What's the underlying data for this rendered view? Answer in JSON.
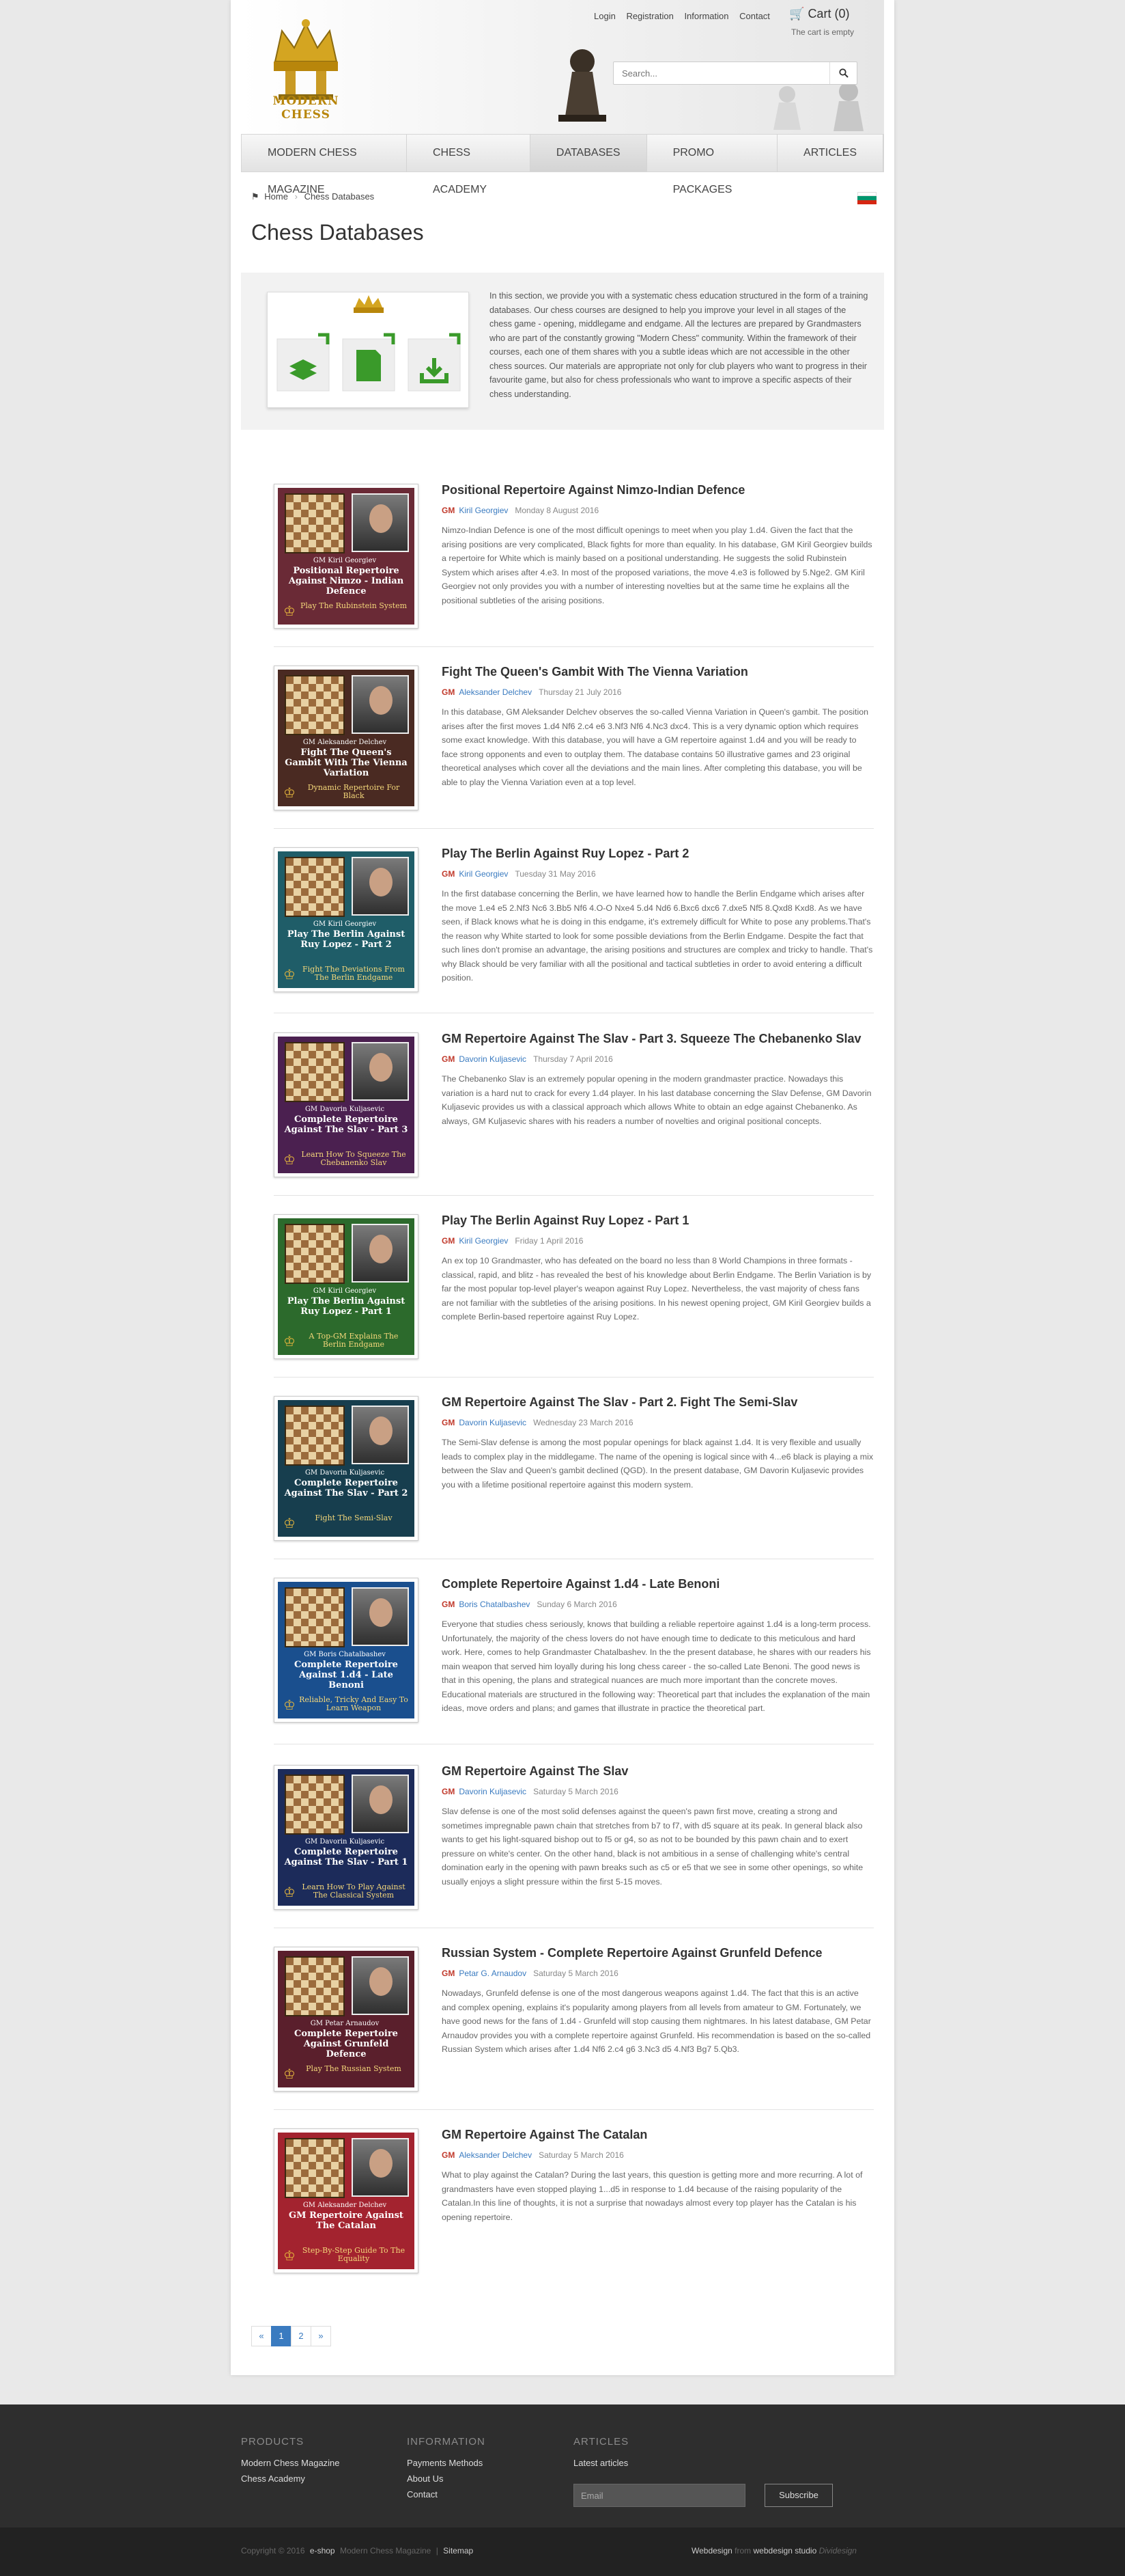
{
  "header": {
    "logo_text": "MODERN CHESS",
    "top_links": [
      "Login",
      "Registration",
      "Information",
      "Contact"
    ],
    "cart_label": "Cart (0)",
    "cart_status": "The cart is empty",
    "search_placeholder": "Search..."
  },
  "nav": [
    "MODERN CHESS MAGAZINE",
    "CHESS ACADEMY",
    "DATABASES",
    "PROMO PACKAGES",
    "ARTICLES"
  ],
  "breadcrumb": {
    "home": "Home",
    "current": "Chess Databases"
  },
  "page_title": "Chess Databases",
  "intro_text": "In this section, we provide you with a systematic chess education structured in the form of a training databases. Our chess courses are designed to help you improve your level in all stages of the chess game - opening, middlegame and endgame. All the lectures are prepared by Grandmasters who are part of the constantly growing \"Modern Chess\" community. Within the framework of their courses, each one of them shares with you a subtle ideas which are not accessible in the other chess sources. Our materials are appropriate not only for club players who want to progress in their favourite game, but also for chess professionals who want to improve a specific aspects of their chess understanding.",
  "items": [
    {
      "title": "Positional Repertoire Against Nimzo-Indian Defence",
      "gm": "GM",
      "author": "Kiril Georgiev",
      "date": "Monday 8 August 2016",
      "cover_gm": "GM Kiril Georgiev",
      "cover_title": "Positional Repertoire Against Nimzo - Indian Defence",
      "cover_sub": "Play The Rubinstein System",
      "color": "#6a2a36",
      "desc": "Nimzo-Indian Defence is one of the most difficult openings to meet when you play 1.d4. Given the fact that the arising positions are very complicated, Black fights for more than equality. In his database, GM Kiril Georgiev builds a repertoire for White which is mainly based on a positional understanding. He suggests the solid Rubinstein System which arises after 4.e3. In most of the proposed variations, the move 4.e3 is followed by 5.Nge2. GM Kiril Georgiev not only provides you with a number of interesting novelties but at the same time he explains all the positional subtleties of the arising positions."
    },
    {
      "title": "Fight The Queen's Gambit With The Vienna Variation",
      "gm": "GM",
      "author": "Aleksander Delchev",
      "date": "Thursday 21 July 2016",
      "cover_gm": "GM Aleksander Delchev",
      "cover_title": "Fight The Queen's Gambit With The Vienna Variation",
      "cover_sub": "Dynamic Repertoire For Black",
      "color": "#4a2a22",
      "desc": "In this database, GM Aleksander Delchev observes the so-called Vienna Variation in Queen's gambit. The position arises after the first moves 1.d4 Nf6 2.c4 e6 3.Nf3 Nf6 4.Nc3 dxc4. This is a very dynamic option which requires some exact knowledge. With this database, you will have a GM repertoire against 1.d4 and you will be ready to face strong opponents and even to outplay them. The database contains 50 illustrative games and 23 original theoretical analyses which cover all the deviations and the main lines. After completing this database, you will be able to play the Vienna Variation even at a top level."
    },
    {
      "title": "Play The Berlin Against Ruy Lopez - Part 2",
      "gm": "GM",
      "author": "Kiril Georgiev",
      "date": "Tuesday 31 May 2016",
      "cover_gm": "GM Kiril Georgiev",
      "cover_title": "Play The Berlin Against Ruy Lopez - Part 2",
      "cover_sub": "Fight The Deviations From The Berlin Endgame",
      "color": "#1f5d68",
      "desc": "In the first database concerning the Berlin, we have learned how to handle the Berlin Endgame which arises after the move 1.e4 e5 2.Nf3 Nc6 3.Bb5 Nf6 4.O-O Nxe4 5.d4 Nd6 6.Bxc6 dxc6 7.dxe5 Nf5 8.Qxd8 Kxd8. As we have seen, if Black knows what he is doing in this endgame, it's extremely difficult for White to pose any problems.That's the reason why White started to look for some possible deviations from the Berlin Endgame. Despite the fact that such lines don't promise an advantage, the arising positions and structures are complex and tricky to handle. That's why Black should be very familiar with all the positional and tactical subtleties in order to avoid entering a difficult position."
    },
    {
      "title": "GM Repertoire Against The Slav - Part 3. Squeeze The Chebanenko Slav",
      "gm": "GM",
      "author": "Davorin Kuljasevic",
      "date": "Thursday 7 April 2016",
      "cover_gm": "GM Davorin Kuljasevic",
      "cover_title": "Complete Repertoire Against The Slav - Part 3",
      "cover_sub": "Learn How To Squeeze The Chebanenko Slav",
      "color": "#4b2050",
      "desc": "The Chebanenko Slav is an extremely popular opening in the modern grandmaster practice. Nowadays this variation is a hard nut to crack for every 1.d4 player. In his last database concerning the Slav Defense, GM Davorin Kuljasevic provides us with a classical approach which allows White to obtain an edge against Chebanenko. As always, GM Kuljasevic shares with his readers a number of novelties and original positional concepts."
    },
    {
      "title": "Play The Berlin Against Ruy Lopez - Part 1",
      "gm": "GM",
      "author": "Kiril Georgiev",
      "date": "Friday 1 April 2016",
      "cover_gm": "GM Kiril Georgiev",
      "cover_title": "Play The Berlin Against Ruy Lopez - Part 1",
      "cover_sub": "A Top-GM Explains The Berlin Endgame",
      "color": "#2c6a2c",
      "desc": "An ex top 10 Grandmaster, who has defeated on the board no less than 8 World Champions in three formats - classical, rapid, and blitz - has revealed the best of his knowledge about Berlin Endgame. The Berlin Variation is by far the most popular top-level player's weapon against Ruy Lopez. Nevertheless, the vast majority of chess fans are not familiar with the subtleties of the arising positions. In his newest opening project, GM Kiril Georgiev builds a complete Berlin-based repertoire against Ruy Lopez."
    },
    {
      "title": "GM Repertoire Against The Slav - Part 2. Fight The Semi-Slav",
      "gm": "GM",
      "author": "Davorin Kuljasevic",
      "date": "Wednesday 23 March 2016",
      "cover_gm": "GM Davorin Kuljasevic",
      "cover_title": "Complete Repertoire Against The Slav - Part 2",
      "cover_sub": "Fight The Semi-Slav",
      "color": "#173e4e",
      "desc": "The Semi-Slav defense is among the most popular openings for black against 1.d4. It is very flexible and usually leads to complex play in the middlegame. The name of the opening is logical since with 4...e6 black is playing a mix between the Slav and Queen's gambit declined (QGD). In the present database, GM Davorin Kuljasevic provides you with a lifetime positional repertoire against this modern system."
    },
    {
      "title": "Complete Repertoire Against 1.d4 - Late Benoni",
      "gm": "GM",
      "author": "Boris Chatalbashev",
      "date": "Sunday 6 March 2016",
      "cover_gm": "GM Boris Chatalbashev",
      "cover_title": "Complete Repertoire Against 1.d4 - Late Benoni",
      "cover_sub": "Reliable, Tricky And Easy To Learn Weapon",
      "color": "#1a4f8e",
      "desc": "Everyone that studies chess seriously, knows that building a reliable repertoire against 1.d4 is a long-term process. Unfortunately, the majority of the chess lovers do not have enough time to dedicate to this meticulous and hard work. Here, comes to help Grandmaster Chatalbashev. In the the present database, he shares with our readers his main weapon that served him loyally during his long chess career - the so-called Late Benoni. The good news is that in this opening, the plans and strategical nuances are much more important than the concrete moves. Educational materials are structured in the following way: Theoretical part that includes the explanation of the main ideas, move orders and plans; and games that illustrate in practice the theoretical part."
    },
    {
      "title": "GM Repertoire Against The Slav",
      "gm": "GM",
      "author": "Davorin Kuljasevic",
      "date": "Saturday 5 March 2016",
      "cover_gm": "GM Davorin Kuljasevic",
      "cover_title": "Complete Repertoire Against The Slav - Part 1",
      "cover_sub": "Learn How To Play Against The Classical System",
      "color": "#1c2b5a",
      "desc": "Slav defense is one of the most solid defenses against the queen's pawn first move, creating a strong and sometimes impregnable pawn chain that stretches from b7 to f7, with d5 square at its peak. In general black also wants to get his light-squared bishop out to f5 or g4, so as not to be bounded by this pawn chain and to exert pressure on white's center. On the other hand, black is not ambitious in a sense of challenging white's central domination early in the opening with pawn breaks such as c5 or e5 that we see in some other openings, so white usually enjoys a slight pressure within the first 5-15 moves."
    },
    {
      "title": "Russian System - Complete Repertoire Against Grunfeld Defence",
      "gm": "GM",
      "author": "Petar G. Arnaudov",
      "date": "Saturday 5 March 2016",
      "cover_gm": "GM Petar Arnaudov",
      "cover_title": "Complete Repertoire Against Grunfeld Defence",
      "cover_sub": "Play The Russian System",
      "color": "#5a1f2c",
      "desc": "Nowadays, Grunfeld defense is one of the most dangerous weapons against 1.d4. The fact that this is an active and complex opening, explains it's popularity among players from all levels from amateur to GM. Fortunately, we have good news for the fans of 1.d4 - Grunfeld will stop causing them nightmares. In his latest database, GM Petar Arnaudov provides you with a complete repertoire against Grunfeld. His recommendation is based on the so-called Russian System which arises after 1.d4 Nf6 2.c4 g6 3.Nc3 d5 4.Nf3 Bg7 5.Qb3."
    },
    {
      "title": "GM Repertoire Against The Catalan",
      "gm": "GM",
      "author": "Aleksander Delchev",
      "date": "Saturday 5 March 2016",
      "cover_gm": "GM Aleksander Delchev",
      "cover_title": "GM Repertoire Against The Catalan",
      "cover_sub": "Step-By-Step Guide To The Equality",
      "color": "#a3232f",
      "desc": "What to play against the Catalan? During the last years, this question is getting more and more recurring. A lot of grandmasters have even stopped playing 1...d5 in response to 1.d4 because of the raising popularity of the Catalan.In this line of thoughts, it is not a surprise that nowadays almost every top player has the Catalan is his opening repertoire."
    }
  ],
  "pagination": [
    "«",
    "1",
    "2",
    "»"
  ],
  "footer": {
    "products_title": "PRODUCTS",
    "products": [
      "Modern Chess Magazine",
      "Chess Academy"
    ],
    "info_title": "INFORMATION",
    "info": [
      "Payments Methods",
      "About Us",
      "Contact"
    ],
    "articles_title": "ARTICLES",
    "articles_sub": "Latest articles",
    "email_placeholder": "Email",
    "subscribe": "Subscribe",
    "copyright_a": "Copyright © 2016",
    "copyright_b": "e-shop",
    "copyright_c": "Modern Chess Magazine",
    "sitemap": "Sitemap",
    "dev_a": "Webdesign",
    "dev_b": "from",
    "dev_c": "webdesign studio",
    "dev_d": "Dividesign"
  }
}
